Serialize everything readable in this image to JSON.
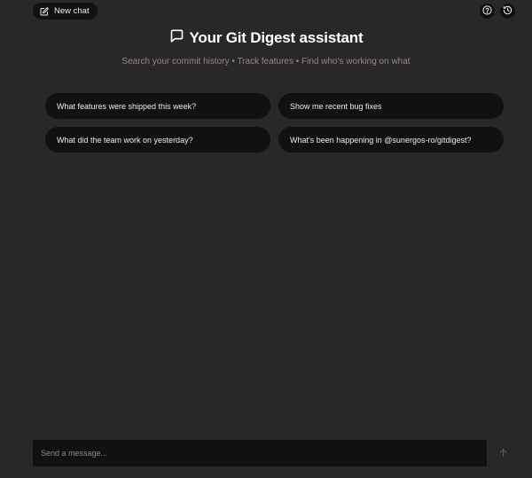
{
  "header": {
    "new_chat_label": "New chat",
    "new_chat_icon": "edit-icon",
    "help_icon": "help-circle-icon",
    "history_icon": "history-icon"
  },
  "hero": {
    "icon": "chat-bubble-icon",
    "title": "Your Git Digest assistant",
    "subtitle": "Search your commit history • Track features • Find who's working on what"
  },
  "suggestions": [
    {
      "label": "What features were shipped this week?"
    },
    {
      "label": "Show me recent bug fixes"
    },
    {
      "label": "What did the team work on yesterday?"
    },
    {
      "label": "What's been happening in @sunergos-ro/gitdigest?"
    }
  ],
  "composer": {
    "placeholder": "Send a message...",
    "value": "",
    "send_icon": "arrow-up-icon"
  },
  "colors": {
    "background": "#2a2727",
    "surface": "#121010",
    "text": "#f0ecea",
    "muted": "#8f8a87"
  }
}
